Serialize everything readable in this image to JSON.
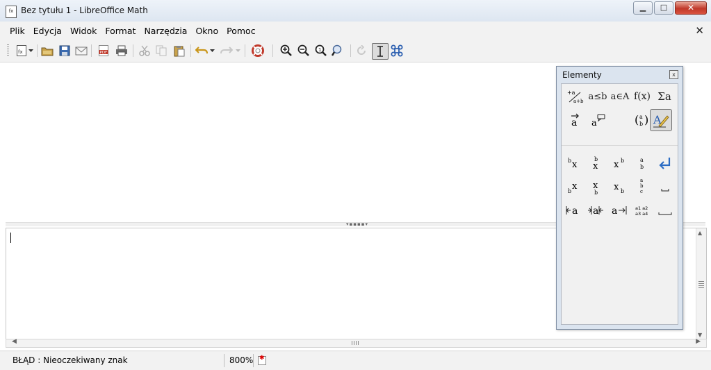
{
  "window": {
    "title": "Bez tytułu 1 - LibreOffice Math",
    "app_icon_label": "fx",
    "buttons": {
      "minimize_glyph": "▁",
      "maximize_glyph": "□",
      "close_glyph": "✕"
    }
  },
  "menubar": {
    "items": [
      "Plik",
      "Edycja",
      "Widok",
      "Format",
      "Narzędzia",
      "Okno",
      "Pomoc"
    ],
    "close_doc_glyph": "✕"
  },
  "toolbar": {
    "icons": [
      "new-formula-icon",
      "new-dropdown-icon",
      "open-folder-icon",
      "save-icon",
      "email-icon",
      "export-pdf-icon",
      "print-icon",
      "cut-icon",
      "copy-icon",
      "paste-icon",
      "undo-icon",
      "undo-dropdown-icon",
      "redo-icon",
      "redo-dropdown-icon",
      "help-lifebuoy-icon",
      "zoom-in-icon",
      "zoom-out-icon",
      "zoom-100-icon",
      "show-all-icon",
      "update-icon",
      "formula-cursor-icon",
      "symbols-icon"
    ],
    "pdf_label": "PDF"
  },
  "elements_panel": {
    "title": "Elementy",
    "close_glyph": "x",
    "categories": [
      {
        "name": "unary-binary-operators",
        "glyph": "+a/a÷b"
      },
      {
        "name": "relations",
        "glyph": "a≤b"
      },
      {
        "name": "set-operations",
        "glyph": "a∈A"
      },
      {
        "name": "functions",
        "glyph": "f(x)"
      },
      {
        "name": "operators",
        "glyph": "Σa"
      },
      {
        "name": "attributes",
        "glyph": "a⃗"
      },
      {
        "name": "others",
        "glyph": "a💬"
      },
      {
        "name": "brackets",
        "glyph": "(a b)"
      },
      {
        "name": "formats",
        "glyph": "A✎"
      }
    ],
    "symbols": [
      {
        "name": "left-superscript",
        "glyph": "ᵇx"
      },
      {
        "name": "top-centered",
        "glyph": "x"
      },
      {
        "name": "right-superscript",
        "glyph": "xᵇ"
      },
      {
        "name": "vertical-stack-2",
        "glyph": "a b"
      },
      {
        "name": "new-line",
        "glyph": "↵"
      },
      {
        "name": "left-subscript",
        "glyph": "ᵦx"
      },
      {
        "name": "bottom-centered",
        "glyph": "x"
      },
      {
        "name": "right-subscript",
        "glyph": "xᵦ"
      },
      {
        "name": "vertical-stack-3",
        "glyph": "a b c"
      },
      {
        "name": "small-gap",
        "glyph": "⎵"
      },
      {
        "name": "align-left",
        "glyph": "⊢a"
      },
      {
        "name": "align-center",
        "glyph": "⊣a⊢"
      },
      {
        "name": "align-right",
        "glyph": "a⊣"
      },
      {
        "name": "matrix",
        "glyph": "a1 a2 a3 a4"
      },
      {
        "name": "gap",
        "glyph": "⎵"
      }
    ]
  },
  "statusbar": {
    "message": "BŁĄD : Nieoczekiwany znak",
    "zoom": "800%"
  },
  "colors": {
    "titlebar": "#dde6f1",
    "close_button": "#c0392b",
    "panel_bg": "#dbe4ef",
    "return_icon": "#2b6cc4"
  }
}
